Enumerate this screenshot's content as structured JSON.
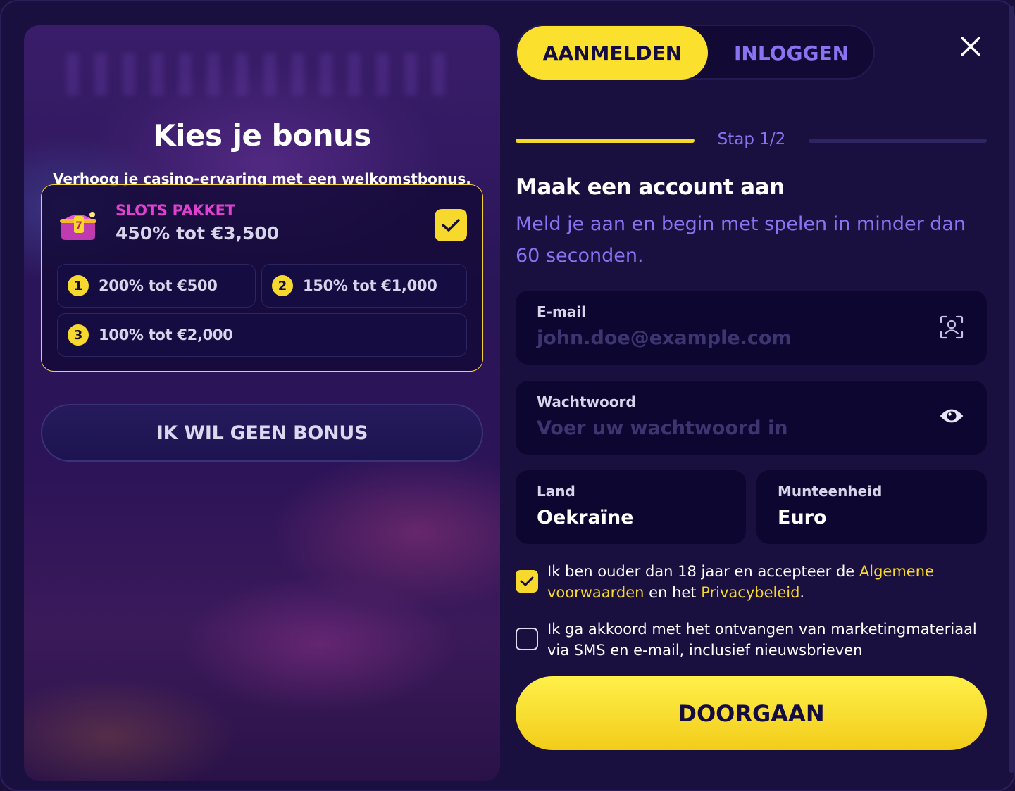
{
  "bonus": {
    "title": "Kies je bonus",
    "subtitle": "Verhoog je casino-ervaring met een welkomstbonus.",
    "package": {
      "name": "SLOTS PAKKET",
      "amount": "450% tot €3,500",
      "icon": "treasure-chest-icon",
      "selected": true
    },
    "tiers": [
      {
        "num": "1",
        "label": "200% tot €500"
      },
      {
        "num": "2",
        "label": "150% tot €1,000"
      },
      {
        "num": "3",
        "label": "100% tot €2,000"
      }
    ],
    "no_bonus_label": "IK WIL GEEN BONUS"
  },
  "tabs": {
    "register": "AANMELDEN",
    "login": "INLOGGEN"
  },
  "step": {
    "label": "Stap 1/2"
  },
  "form": {
    "title": "Maak een account aan",
    "subtitle": "Meld je aan en begin met spelen in minder dan 60 seconden.",
    "email": {
      "label": "E-mail",
      "placeholder": "john.doe@example.com"
    },
    "password": {
      "label": "Wachtwoord",
      "placeholder": "Voer uw wachtwoord in"
    },
    "country": {
      "label": "Land",
      "value": "Oekraïne"
    },
    "currency": {
      "label": "Munteenheid",
      "value": "Euro"
    },
    "terms": {
      "checked": true,
      "text_before": "Ik ben ouder dan 18 jaar en accepteer de ",
      "link_terms": "Algemene voorwaarden",
      "text_middle": " en het ",
      "link_privacy": "Privacybeleid",
      "text_after": "."
    },
    "marketing": {
      "checked": false,
      "text": "Ik ga akkoord met het ontvangen van marketingmateriaal via SMS en e-mail, inclusief nieuwsbrieven"
    },
    "continue_label": "DOORGAAN"
  },
  "colors": {
    "accent": "#f7d92e",
    "purple_text": "#8a72f0",
    "background": "#1a1040",
    "package_name": "#e040d0"
  }
}
